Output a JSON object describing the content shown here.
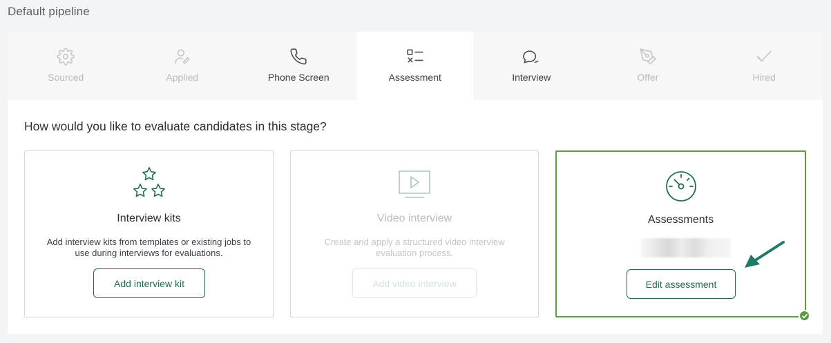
{
  "pipeline": {
    "title": "Default pipeline"
  },
  "stages": [
    {
      "label": "Sourced",
      "icon": "gear-icon",
      "state": "muted"
    },
    {
      "label": "Applied",
      "icon": "user-edit-icon",
      "state": "muted"
    },
    {
      "label": "Phone Screen",
      "icon": "phone-icon",
      "state": "normal"
    },
    {
      "label": "Assessment",
      "icon": "checklist-icon",
      "state": "active"
    },
    {
      "label": "Interview",
      "icon": "chat-bubbles-icon",
      "state": "normal"
    },
    {
      "label": "Offer",
      "icon": "pen-nib-icon",
      "state": "muted"
    },
    {
      "label": "Hired",
      "icon": "checkmark-icon",
      "state": "muted"
    }
  ],
  "panel": {
    "question": "How would you like to evaluate candidates in this stage?",
    "cards": [
      {
        "title": "Interview kits",
        "description": "Add interview kits from templates or existing jobs to use during interviews for evaluations.",
        "button": "Add interview kit",
        "icon": "stars-icon"
      },
      {
        "title": "Video interview",
        "description": "Create and apply a structured video interview evaluation process.",
        "button": "Add video interview",
        "icon": "video-play-icon",
        "disabled": true
      },
      {
        "title": "Assessments",
        "button": "Edit assessment",
        "icon": "gauge-icon",
        "selected": true
      }
    ]
  },
  "colors": {
    "accent": "#1f6b55",
    "selected_border": "#5e9a43",
    "arrow": "#1f7a66"
  }
}
